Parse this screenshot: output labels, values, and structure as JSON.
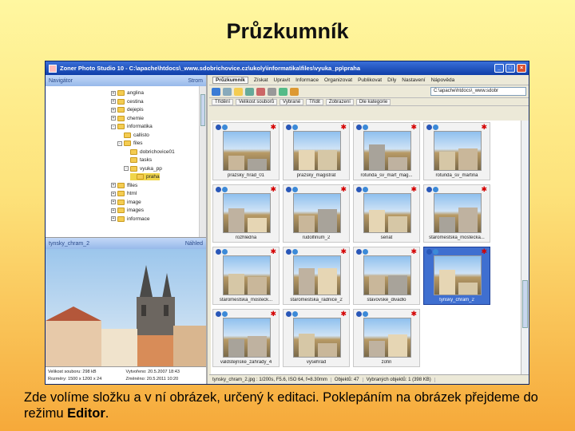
{
  "slide": {
    "title": "Průzkumník",
    "caption_text": "Zde volíme složku a v ní obrázek, určený k editaci. Poklepáním na obrázek přejdeme do režimu ",
    "caption_bold": "Editor",
    "caption_end": "."
  },
  "window": {
    "title": "Zoner Photo Studio 10 - C:\\apache\\htdocs\\_www.sdobrichovice.cz\\ukoly\\informatika\\files\\vyuka_pp\\praha",
    "min": "_",
    "max": "□",
    "close": "×"
  },
  "navigator": {
    "label": "Navigátor",
    "mode": "Strom",
    "items": [
      {
        "label": "anglina",
        "indent": 0,
        "pm": "+"
      },
      {
        "label": "cestina",
        "indent": 0,
        "pm": "+"
      },
      {
        "label": "dejepis",
        "indent": 0,
        "pm": "+"
      },
      {
        "label": "chemie",
        "indent": 0,
        "pm": "+"
      },
      {
        "label": "informatika",
        "indent": 0,
        "pm": "-"
      },
      {
        "label": "callisto",
        "indent": 1,
        "pm": ""
      },
      {
        "label": "files",
        "indent": 1,
        "pm": "-"
      },
      {
        "label": "dobrichovice01",
        "indent": 2,
        "pm": ""
      },
      {
        "label": "tasks",
        "indent": 2,
        "pm": ""
      },
      {
        "label": "vyuka_pp",
        "indent": 2,
        "pm": "-"
      },
      {
        "label": "praha",
        "indent": 3,
        "pm": "",
        "selected": true
      },
      {
        "label": "ffiles",
        "indent": 0,
        "pm": "+"
      },
      {
        "label": "html",
        "indent": 0,
        "pm": "+"
      },
      {
        "label": "image",
        "indent": 0,
        "pm": "+"
      },
      {
        "label": "images",
        "indent": 0,
        "pm": "+"
      },
      {
        "label": "informace",
        "indent": 0,
        "pm": "+"
      }
    ]
  },
  "preview": {
    "label": "tynsky_chram_2",
    "mode": "Náhled",
    "info": [
      "Velikost souboru: 298 kB",
      "Vytvořeno: 20.5.2007 18:43",
      "Rozměry: 1500 x 1200 x 24",
      "Změněno: 20.5.2011 10:20"
    ]
  },
  "menu": {
    "items": [
      "Průzkumník",
      "Získat",
      "Upravit",
      "Informace",
      "Organizovat",
      "Publikovat",
      "Díly",
      "Nastavení",
      "Nápověda"
    ]
  },
  "toolbar": {
    "path": "C:\\apache\\htdocs\\_www.sdobr"
  },
  "columns": [
    "Třídění",
    "Velikost souborů",
    "Vybrané",
    "Třídit",
    "Zobrazení",
    "Dle kategorie"
  ],
  "thumbnails": [
    {
      "label": "prazsky_hrad_01"
    },
    {
      "label": "prazsky_magistrat"
    },
    {
      "label": "rotunda_sv_mart_mag..."
    },
    {
      "label": "rotunda_sv_martina"
    },
    {
      "label": "rozhledna"
    },
    {
      "label": "rudolfinum_2"
    },
    {
      "label": "senat"
    },
    {
      "label": "staromestska_mostecka..."
    },
    {
      "label": "staromestska_mosteck..."
    },
    {
      "label": "staromestska_radnice_2"
    },
    {
      "label": "stavovske_divadlo"
    },
    {
      "label": "tynsky_chram_2",
      "selected": true
    },
    {
      "label": "valdstejnske_zahrady_4"
    },
    {
      "label": "vysehrad"
    },
    {
      "label": "zofin"
    }
  ],
  "status": [
    "tynsky_chram_2.jpg : 1/200s, F5.6, ISO 64, f=8.30mm",
    "Objektů: 47",
    "Vybraných objektů: 1 (398 KB)"
  ],
  "colors": {
    "accent": "#0f3ea8",
    "selection": "#3f6fd0",
    "folder": "#f4cc52"
  }
}
